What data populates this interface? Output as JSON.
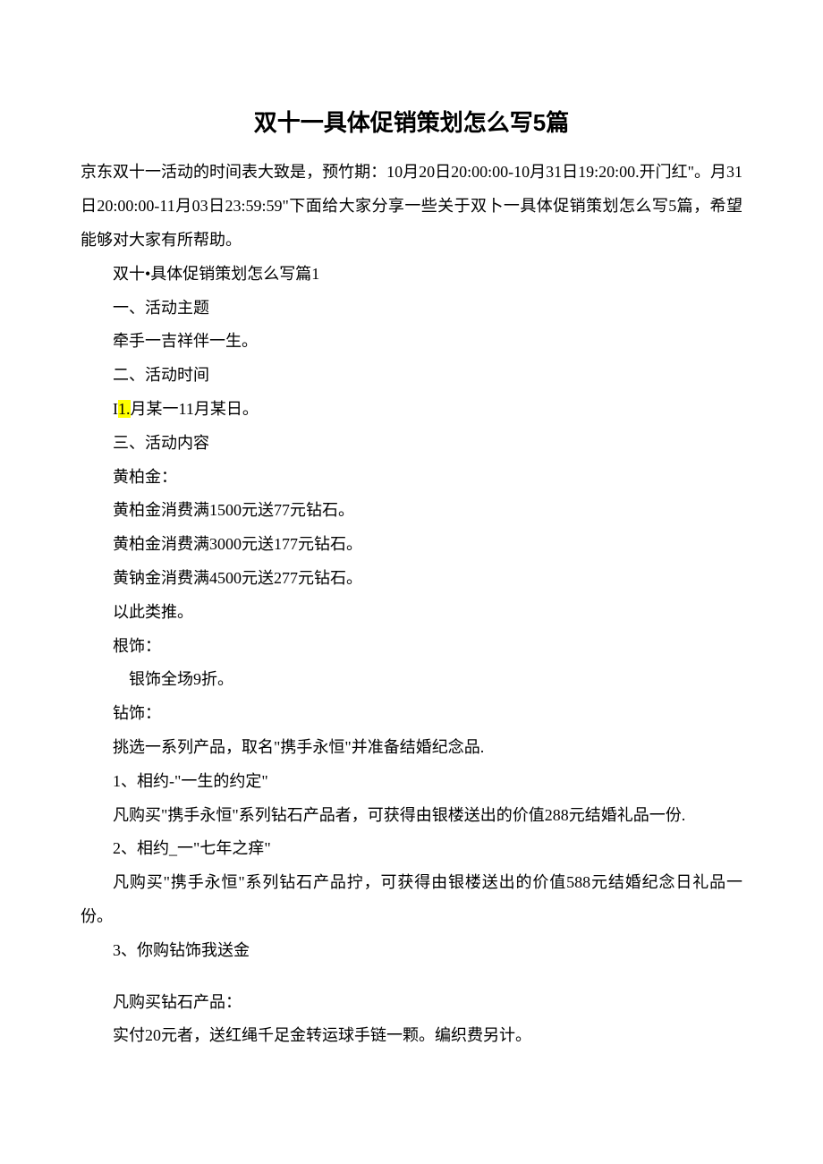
{
  "title": "双十一具体促销策划怎么写5篇",
  "intro": "京东双十一活动的时间表大致是，预竹期：10月20日20:00:00-10月31日19:20:00.开门红\"。月31日20:00:00-11月03日23:59:59\"下面给大家分享一些关于双卜一具体促销策划怎么写5篇，希望能够对大家有所帮助。",
  "p1": "双十•具体促销策划怎么写篇1",
  "p2": "一、活动主题",
  "p3": "牵手一吉祥伴一生。",
  "p4": "二、活动时间",
  "p5_pre": "I",
  "p5_hl": "1.",
  "p5_post": "月某一11月某日。",
  "p6": "三、活动内容",
  "p7": "黄柏金：",
  "p8": "黄柏金消费满1500元送77元钻石。",
  "p9": "黄柏金消费满3000元送177元钻石。",
  "p10": "黄钠金消费满4500元送277元钻石。",
  "p11": "以此类推。",
  "p12": "根饰：",
  "p13": "银饰全场9折。",
  "p14": "钻饰：",
  "p15": "挑选一系列产品，取名\"携手永恒\"并准备结婚纪念品.",
  "p16": "1、相约-\"一生的约定\"",
  "p17": "凡购买\"携手永恒\"系列钻石产品者，可获得由银楼送出的价值288元结婚礼品一份.",
  "p18": "2、相约_一\"七年之痒\"",
  "p19": "凡购买\"携手永恒\"系列钻石产品拧，可获得由银楼送出的价值588元结婚纪念日礼品一份。",
  "p20": "3、你购钻饰我送金",
  "p21": "凡购买钻石产品：",
  "p22": "实付20元者，送红绳千足金转运球手链一颗。编织费另计。"
}
